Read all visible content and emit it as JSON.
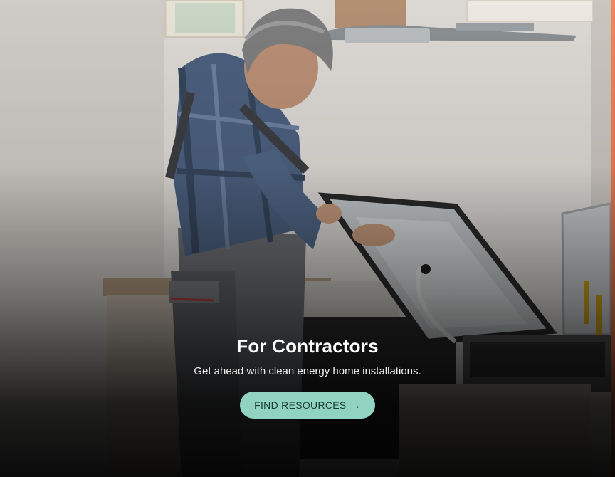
{
  "card": {
    "title": "For Contractors",
    "subtitle": "Get ahead with clean energy home installations.",
    "cta_label": "FIND RESOURCES",
    "cta_arrow": "→"
  },
  "colors": {
    "cta_background": "#8fd3c0",
    "cta_text": "#183a33",
    "accent_edge": "#e8754a",
    "title_text": "#ffffff"
  },
  "icons": {
    "cta_arrow": "arrow-right-icon"
  }
}
